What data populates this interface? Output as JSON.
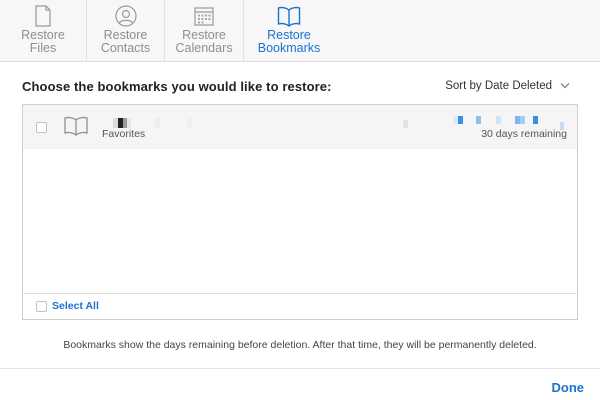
{
  "tabs": [
    {
      "line1": "Restore",
      "line2": "Files",
      "icon": "document-icon",
      "active": false
    },
    {
      "line1": "Restore",
      "line2": "Contacts",
      "icon": "contact-icon",
      "active": false
    },
    {
      "line1": "Restore",
      "line2": "Calendars",
      "icon": "calendar-icon",
      "active": false
    },
    {
      "line1": "Restore",
      "line2": "Bookmarks",
      "icon": "book-icon",
      "active": true
    }
  ],
  "heading": "Choose the bookmarks you would like to restore:",
  "sort": {
    "label": "Sort by Date Deleted",
    "icon": "chevron-down-icon"
  },
  "list": {
    "items": [
      {
        "subtitle": "Favorites",
        "remaining": "30 days remaining",
        "icon": "book-icon"
      }
    ],
    "select_all": "Select All"
  },
  "note": "Bookmarks show the days remaining before deletion. After that time, they will be permanently deleted.",
  "done": "Done",
  "colors": {
    "accent": "#1a73d1",
    "inactive": "#8e8e8e"
  }
}
